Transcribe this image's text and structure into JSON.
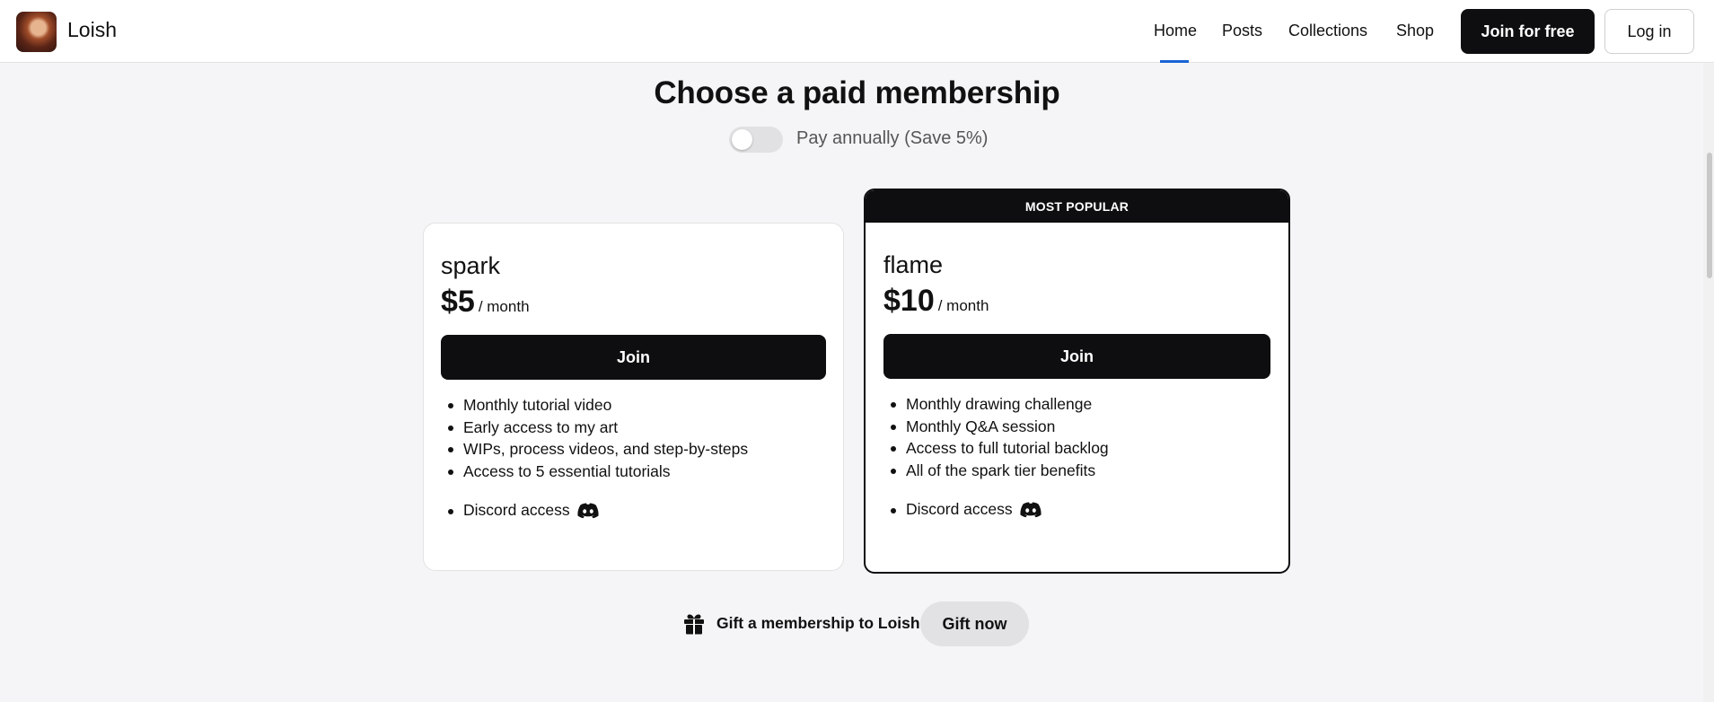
{
  "header": {
    "creator_name": "Loish",
    "nav": [
      "Home",
      "Posts",
      "Collections",
      "Shop"
    ],
    "active_nav": "Home",
    "join_label": "Join for free",
    "login_label": "Log in"
  },
  "membership": {
    "heading": "Choose a paid membership",
    "toggle_label": "Pay annually (Save 5%)",
    "toggle_on": false,
    "tiers": [
      {
        "name": "spark",
        "price": "$5",
        "period": "/ month",
        "join_label": "Join",
        "benefits": [
          "Monthly tutorial video",
          "Early access to my art",
          "WIPs, process videos, and step-by-steps",
          "Access to 5 essential tutorials"
        ],
        "discord": "Discord access"
      },
      {
        "name": "flame",
        "badge": "MOST POPULAR",
        "price": "$10",
        "period": "/ month",
        "join_label": "Join",
        "benefits": [
          "Monthly drawing challenge",
          "Monthly Q&A session",
          "Access to full tutorial backlog",
          "All of the spark tier benefits"
        ],
        "discord": "Discord access"
      }
    ]
  },
  "gift": {
    "text": "Gift a membership to Loish",
    "button": "Gift now"
  },
  "colors": {
    "accent": "#0e0e10",
    "nav_underline": "#1a64d4",
    "page_bg": "#f5f5f7"
  },
  "icons": [
    "creator-avatar",
    "discord-icon",
    "gift-icon"
  ]
}
